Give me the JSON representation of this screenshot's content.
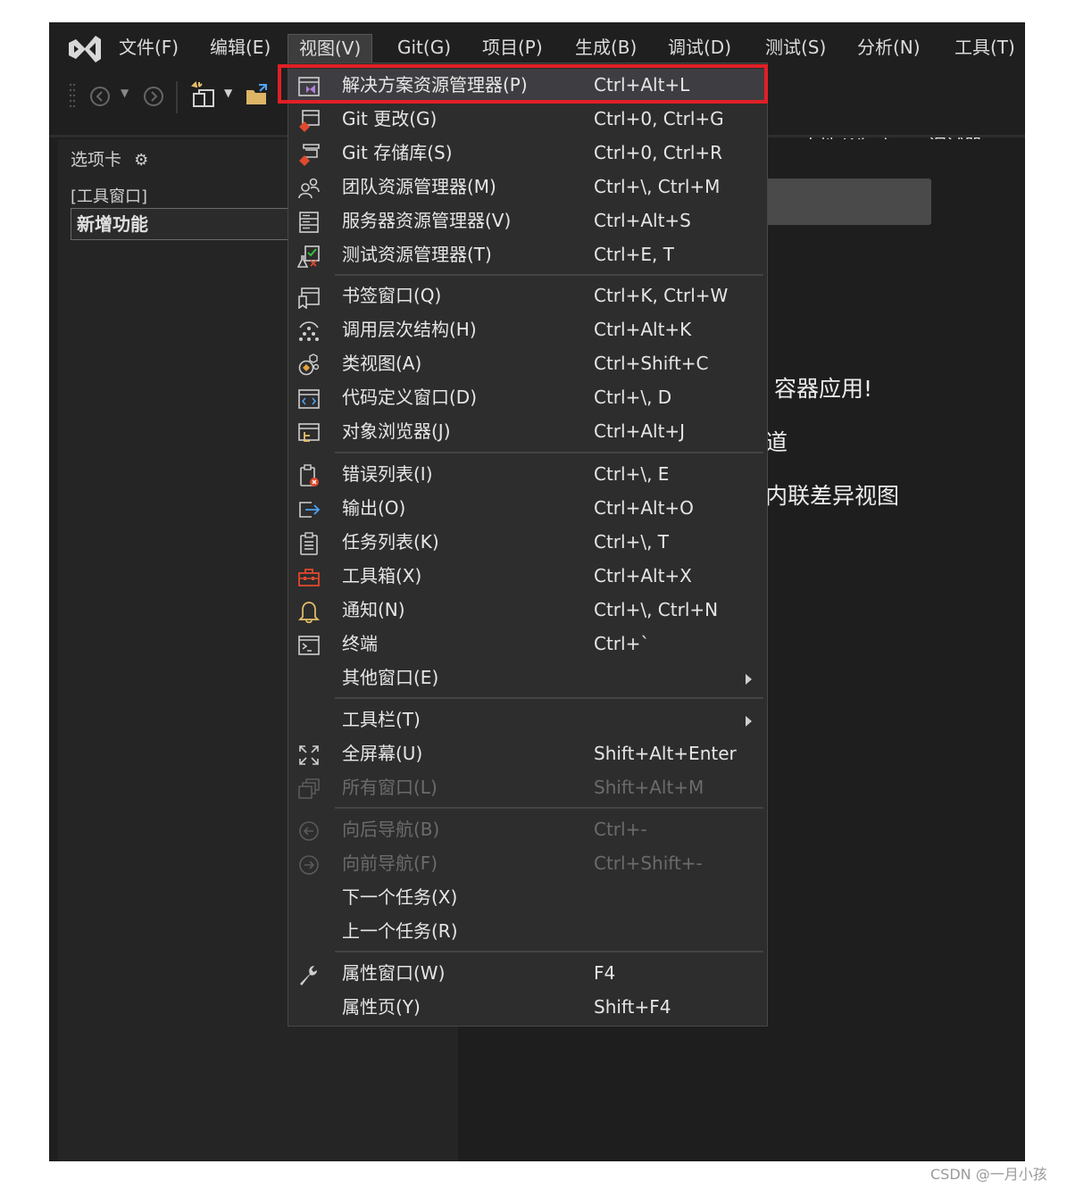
{
  "menubar": {
    "items": [
      "文件(F)",
      "编辑(E)",
      "视图(V)",
      "Git(G)",
      "项目(P)",
      "生成(B)",
      "调试(D)",
      "测试(S)",
      "分析(N)",
      "工具(T)"
    ],
    "active_index": 2
  },
  "toolbar": {
    "debug_target": "本地 Windows 调试器"
  },
  "left_panel": {
    "tab_title": "选项卡",
    "tool_window_label": "[工具窗口]",
    "feature_box": "新增功能"
  },
  "background_text": {
    "line1": "容器应用!",
    "line2": "道",
    "line3": "内联差异视图"
  },
  "view_menu": {
    "items": [
      {
        "label": "解决方案资源管理器(P)",
        "shortcut": "Ctrl+Alt+L",
        "icon": "solution-explorer-icon",
        "highlighted": true
      },
      {
        "label": "Git 更改(G)",
        "shortcut": "Ctrl+0, Ctrl+G",
        "icon": "git-changes-icon"
      },
      {
        "label": "Git 存储库(S)",
        "shortcut": "Ctrl+0, Ctrl+R",
        "icon": "git-repository-icon"
      },
      {
        "label": "团队资源管理器(M)",
        "shortcut": "Ctrl+\\, Ctrl+M",
        "icon": "team-explorer-icon"
      },
      {
        "label": "服务器资源管理器(V)",
        "shortcut": "Ctrl+Alt+S",
        "icon": "server-explorer-icon"
      },
      {
        "label": "测试资源管理器(T)",
        "shortcut": "Ctrl+E, T",
        "icon": "test-explorer-icon"
      },
      {
        "label": "书签窗口(Q)",
        "shortcut": "Ctrl+K, Ctrl+W",
        "icon": "bookmark-window-icon"
      },
      {
        "label": "调用层次结构(H)",
        "shortcut": "Ctrl+Alt+K",
        "icon": "call-hierarchy-icon"
      },
      {
        "label": "类视图(A)",
        "shortcut": "Ctrl+Shift+C",
        "icon": "class-view-icon"
      },
      {
        "label": "代码定义窗口(D)",
        "shortcut": "Ctrl+\\, D",
        "icon": "code-definition-icon"
      },
      {
        "label": "对象浏览器(J)",
        "shortcut": "Ctrl+Alt+J",
        "icon": "object-browser-icon"
      },
      {
        "label": "错误列表(I)",
        "shortcut": "Ctrl+\\, E",
        "icon": "error-list-icon"
      },
      {
        "label": "输出(O)",
        "shortcut": "Ctrl+Alt+O",
        "icon": "output-icon"
      },
      {
        "label": "任务列表(K)",
        "shortcut": "Ctrl+\\, T",
        "icon": "task-list-icon"
      },
      {
        "label": "工具箱(X)",
        "shortcut": "Ctrl+Alt+X",
        "icon": "toolbox-icon"
      },
      {
        "label": "通知(N)",
        "shortcut": "Ctrl+\\, Ctrl+N",
        "icon": "bell-icon"
      },
      {
        "label": "终端",
        "shortcut": "Ctrl+`",
        "icon": "terminal-icon"
      },
      {
        "label": "其他窗口(E)",
        "shortcut": "",
        "submenu": true
      },
      {
        "label": "工具栏(T)",
        "shortcut": "",
        "submenu": true
      },
      {
        "label": "全屏幕(U)",
        "shortcut": "Shift+Alt+Enter",
        "icon": "fullscreen-icon"
      },
      {
        "label": "所有窗口(L)",
        "shortcut": "Shift+Alt+M",
        "icon": "all-windows-icon",
        "disabled": true
      },
      {
        "label": "向后导航(B)",
        "shortcut": "Ctrl+-",
        "icon": "navigate-back-icon",
        "disabled": true
      },
      {
        "label": "向前导航(F)",
        "shortcut": "Ctrl+Shift+-",
        "icon": "navigate-forward-icon",
        "disabled": true
      },
      {
        "label": "下一个任务(X)",
        "shortcut": ""
      },
      {
        "label": "上一个任务(R)",
        "shortcut": ""
      },
      {
        "label": "属性窗口(W)",
        "shortcut": "F4",
        "icon": "wrench-icon"
      },
      {
        "label": "属性页(Y)",
        "shortcut": "Shift+F4"
      }
    ]
  },
  "watermark": "CSDN @一月小孩",
  "colors": {
    "highlight_border": "#e01f26",
    "background": "#1f1f1f",
    "menu_background": "#2d2d2d",
    "play_green": "#3cc83c"
  }
}
